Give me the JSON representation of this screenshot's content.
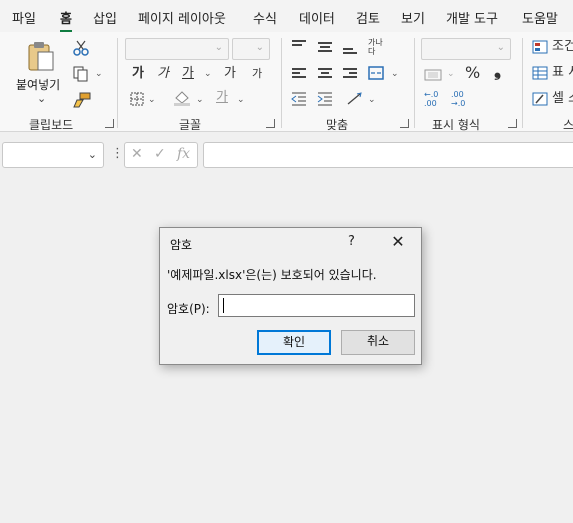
{
  "menu": [
    {
      "label": "파일",
      "active": false
    },
    {
      "label": "홈",
      "active": true
    },
    {
      "label": "삽입",
      "active": false
    },
    {
      "label": "페이지 레이아웃",
      "active": false
    },
    {
      "label": "수식",
      "active": false
    },
    {
      "label": "데이터",
      "active": false
    },
    {
      "label": "검토",
      "active": false
    },
    {
      "label": "보기",
      "active": false
    },
    {
      "label": "개발 도구",
      "active": false
    },
    {
      "label": "도움말",
      "active": false
    }
  ],
  "ribbon": {
    "groups": {
      "clipboard": "클립보드",
      "font": "글꼴",
      "alignment": "맞춤",
      "number": "표시 형식",
      "styles": "스"
    },
    "paste_label": "붙여넣기",
    "paste_caret": "⌄",
    "font_buttons": {
      "bold": "가",
      "italic": "가",
      "underline": "가",
      "grow": "가",
      "shrink": "가",
      "font_color": "가"
    },
    "wrap_text": "가나\n다",
    "percent": "%",
    "comma": "❟",
    "inc_decimal": "←.0\n.00",
    "dec_decimal": ".00\n→.0",
    "styles_items": [
      "조건",
      "표 서",
      "셀 스"
    ]
  },
  "formula_bar": {
    "cancel_symbol": "✕",
    "enter_symbol": "✓",
    "fx_symbol": "fx",
    "more_symbol": "⋮"
  },
  "dialog": {
    "title": "암호",
    "help": "?",
    "close": "✕",
    "message": "'예제파일.xlsx'은(는) 보호되어 있습니다.",
    "password_label": "암호(P):",
    "password_value": "",
    "ok_label": "확인",
    "cancel_label": "취소"
  }
}
